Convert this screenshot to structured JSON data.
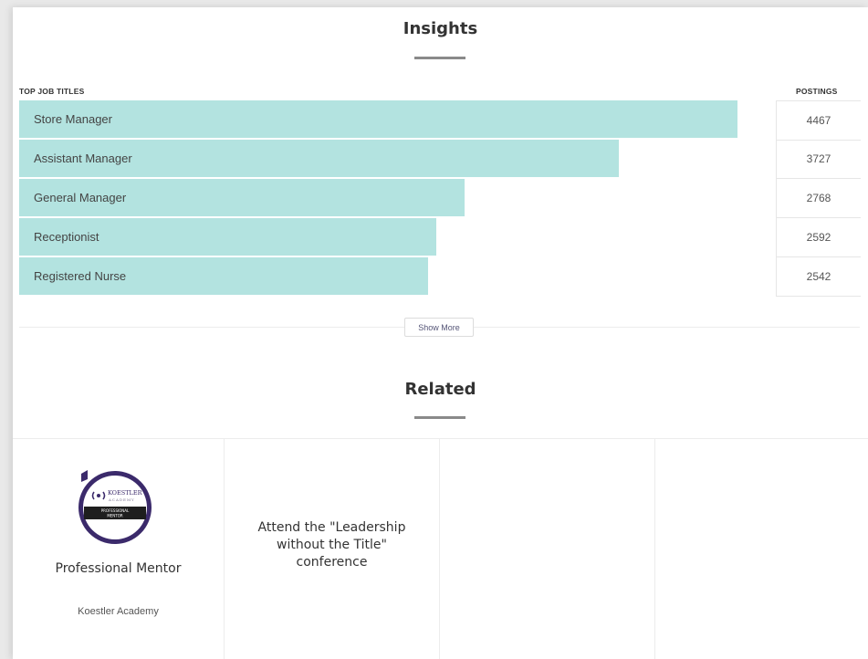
{
  "insights": {
    "title": "Insights",
    "left_header": "TOP JOB TITLES",
    "right_header": "POSTINGS",
    "rows": [
      {
        "title": "Store Manager",
        "postings": "4467",
        "value": 4467
      },
      {
        "title": "Assistant Manager",
        "postings": "3727",
        "value": 3727
      },
      {
        "title": "General Manager",
        "postings": "2768",
        "value": 2768
      },
      {
        "title": "Receptionist",
        "postings": "2592",
        "value": 2592
      },
      {
        "title": "Registered Nurse",
        "postings": "2542",
        "value": 2542
      }
    ],
    "bar_max": 4467,
    "bar_color": "#b3e3e0",
    "show_more_label": "Show More"
  },
  "related": {
    "title": "Related",
    "cards": [
      {
        "title": "Professional Mentor",
        "subtitle": "Koestler Academy",
        "badge": {
          "brand": "KOESTLER",
          "sub": "ACADEMY",
          "ribbon_line1": "PROFESSIONAL",
          "ribbon_line2": "MENTOR",
          "ring_color": "#3b2a6b"
        }
      },
      {
        "title": "Attend the \"Leadership without the Title\" conference",
        "title_lines": [
          "Attend the \"Leadership",
          "without the Title\"",
          "conference"
        ]
      },
      {},
      {}
    ]
  }
}
